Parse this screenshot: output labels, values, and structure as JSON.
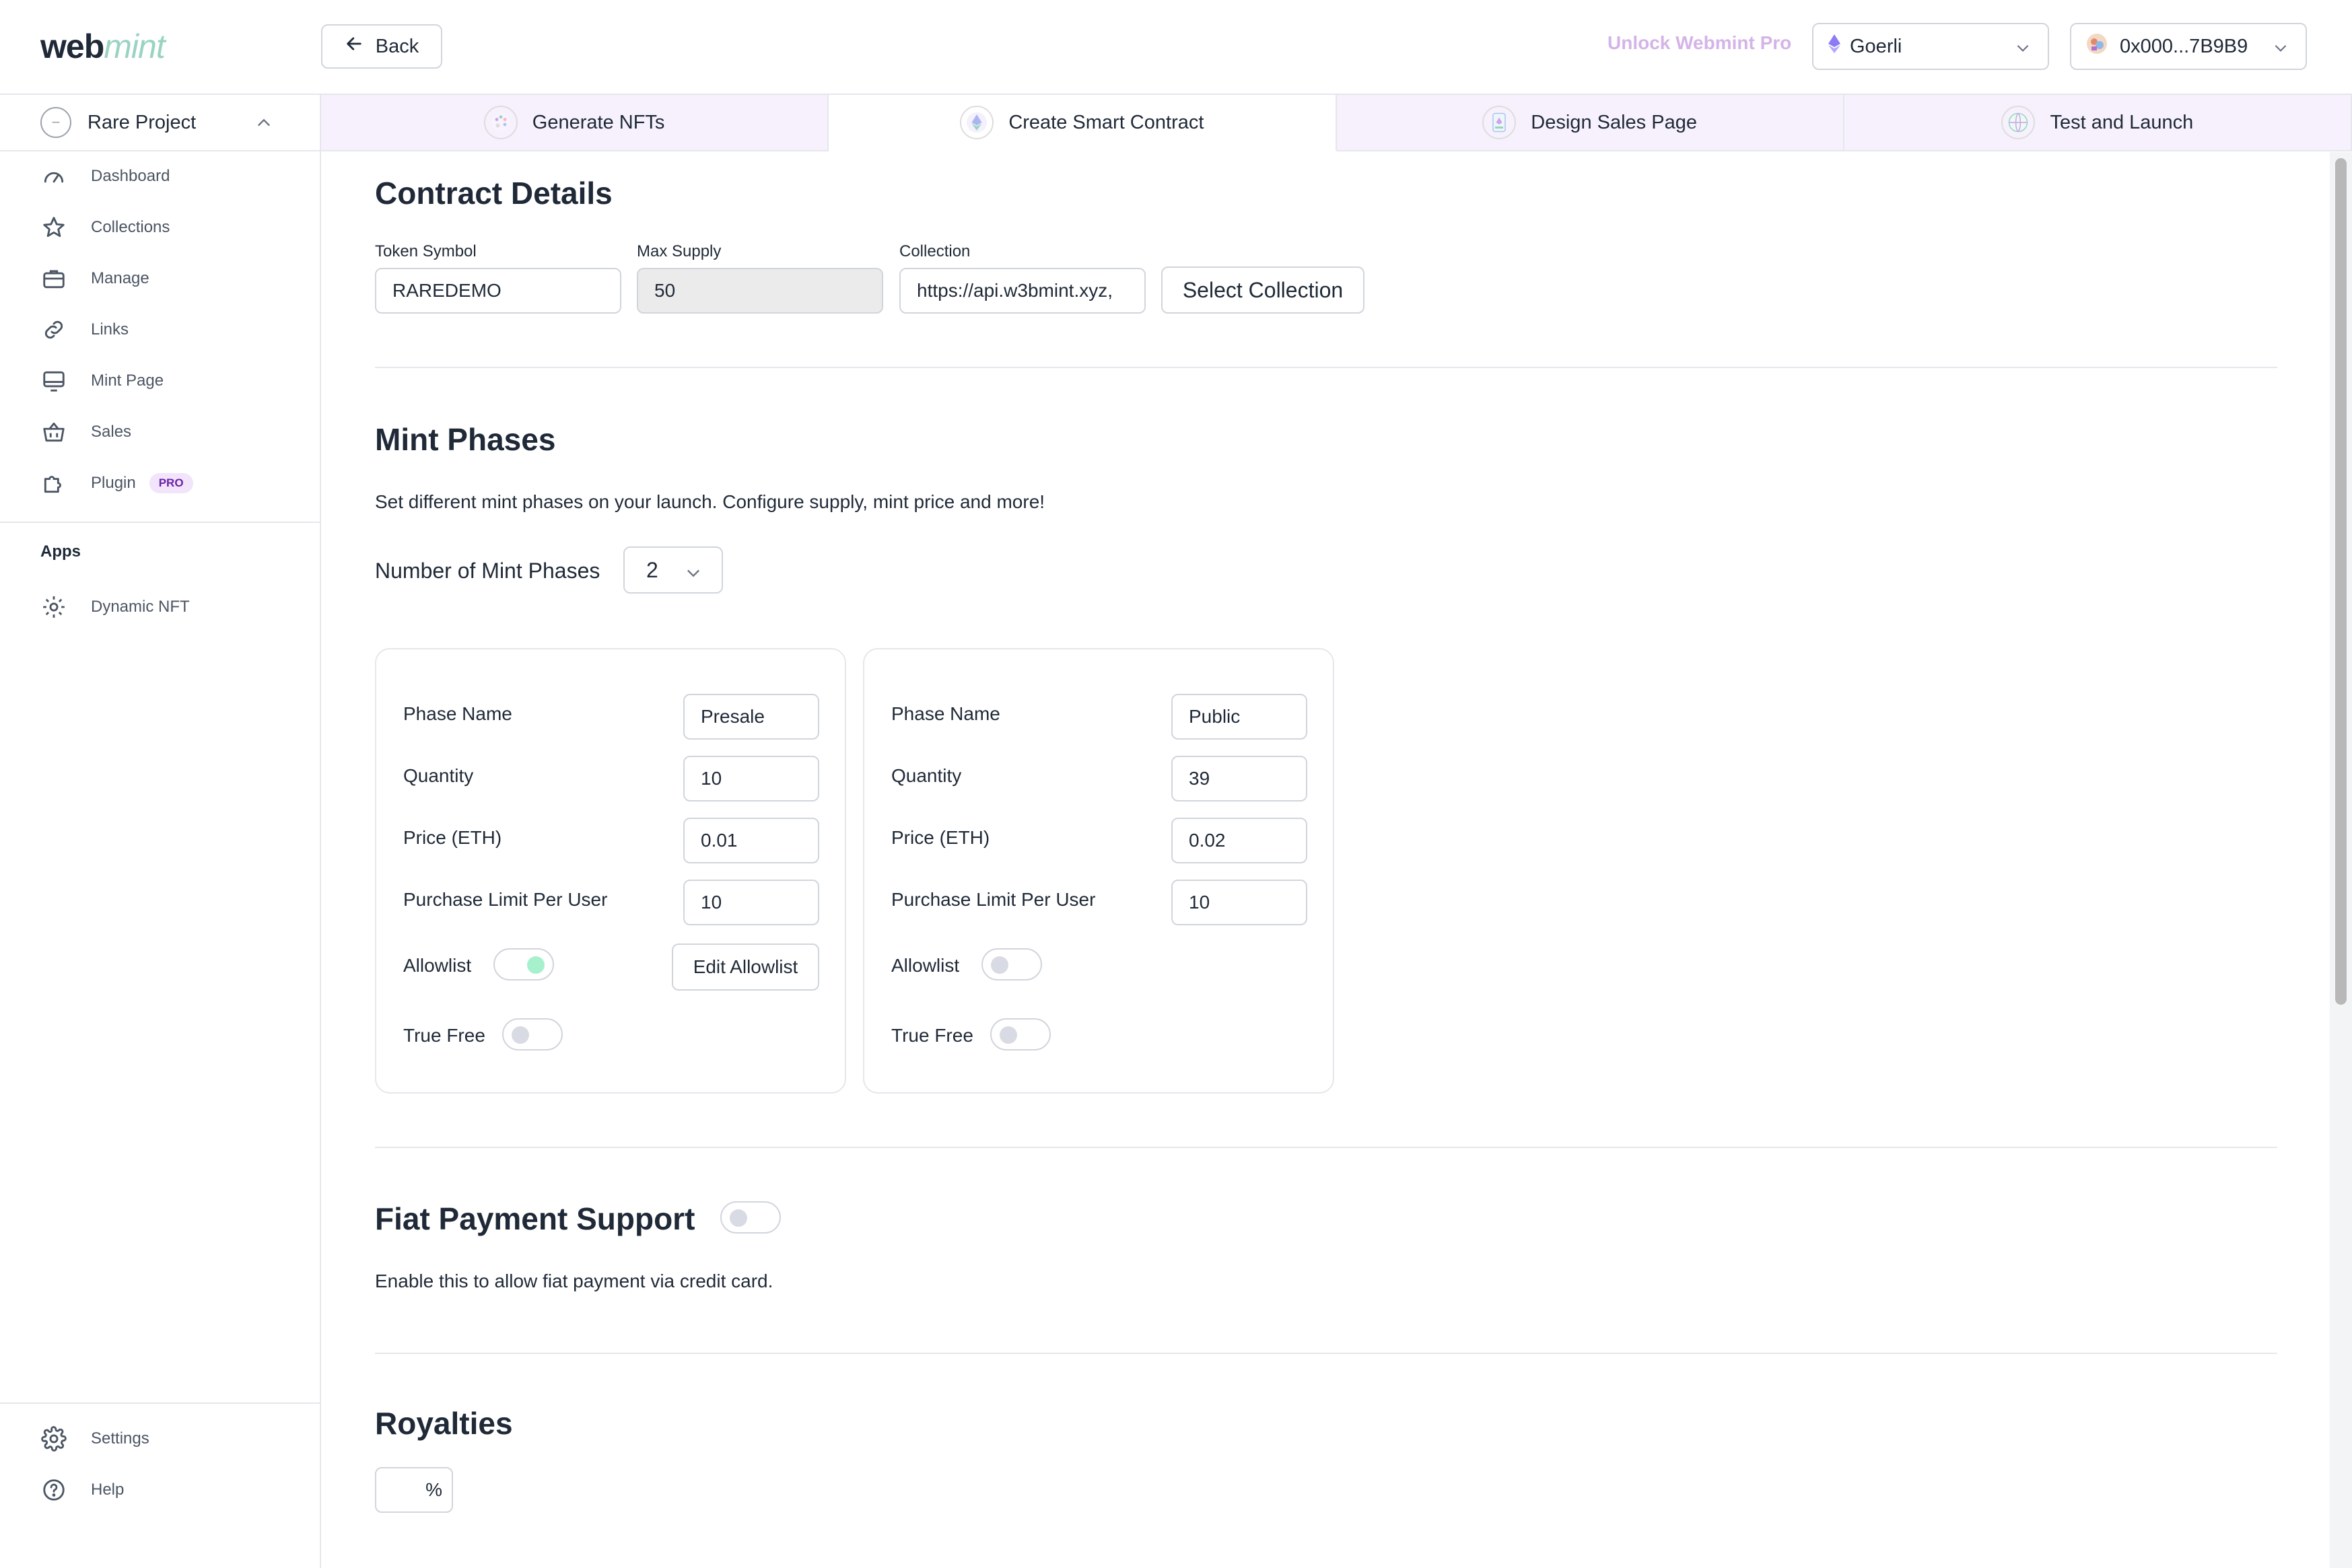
{
  "header": {
    "logo_web": "web",
    "logo_mint": "mint",
    "back_label": "Back",
    "unlock_label": "Unlock Webmint Pro",
    "network": "Goerli",
    "wallet": "0x000...7B9B9",
    "accent_color": "#d4b4e8"
  },
  "sidebar": {
    "project": "Rare Project",
    "items": [
      {
        "label": "Dashboard",
        "icon": "gauge-icon"
      },
      {
        "label": "Collections",
        "icon": "star-icon"
      },
      {
        "label": "Manage",
        "icon": "briefcase-icon"
      },
      {
        "label": "Links",
        "icon": "link-icon"
      },
      {
        "label": "Mint Page",
        "icon": "monitor-icon"
      },
      {
        "label": "Sales",
        "icon": "basket-icon"
      },
      {
        "label": "Plugin",
        "icon": "puzzle-icon",
        "badge": "PRO"
      }
    ],
    "apps_heading": "Apps",
    "apps": [
      {
        "label": "Dynamic NFT",
        "icon": "gear-icon"
      }
    ],
    "bottom": [
      {
        "label": "Settings",
        "icon": "settings-icon"
      },
      {
        "label": "Help",
        "icon": "help-icon"
      }
    ]
  },
  "tabs": [
    {
      "label": "Generate NFTs",
      "active": false
    },
    {
      "label": "Create Smart Contract",
      "active": true
    },
    {
      "label": "Design Sales Page",
      "active": false
    },
    {
      "label": "Test and Launch",
      "active": false
    }
  ],
  "contract": {
    "title": "Contract Details",
    "token_symbol_label": "Token Symbol",
    "token_symbol": "RAREDEMO",
    "max_supply_label": "Max Supply",
    "max_supply": "50",
    "collection_label": "Collection",
    "collection": "https://api.w3bmint.xyz,",
    "select_collection": "Select Collection"
  },
  "mint_phases": {
    "title": "Mint Phases",
    "description": "Set different mint phases on your launch. Configure supply, mint price and more!",
    "count_label": "Number of Mint Phases",
    "count": "2",
    "field_labels": {
      "name": "Phase Name",
      "quantity": "Quantity",
      "price": "Price (ETH)",
      "limit": "Purchase Limit Per User",
      "allowlist": "Allowlist",
      "true_free": "True Free",
      "edit_allowlist": "Edit Allowlist"
    },
    "phases": [
      {
        "name": "Presale",
        "quantity": "10",
        "price": "0.01",
        "limit": "10",
        "allowlist": true,
        "true_free": false
      },
      {
        "name": "Public",
        "quantity": "39",
        "price": "0.02",
        "limit": "10",
        "allowlist": false,
        "true_free": false
      }
    ]
  },
  "fiat": {
    "title": "Fiat Payment Support",
    "description": "Enable this to allow fiat payment via credit card.",
    "enabled": false
  },
  "royalties": {
    "title": "Royalties",
    "value": "",
    "unit": "%"
  }
}
